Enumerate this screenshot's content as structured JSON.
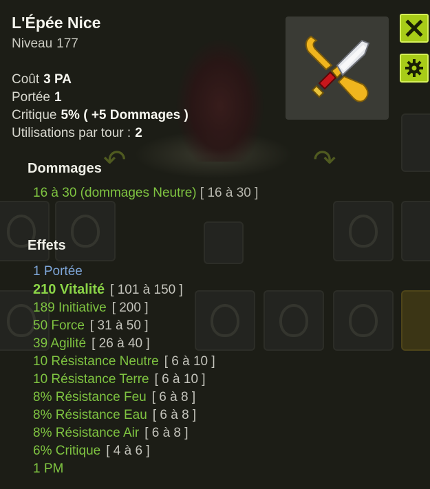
{
  "item": {
    "name": "L'Épée Nice",
    "level_label": "Niveau",
    "level": "177"
  },
  "stats": [
    {
      "label": "Coût",
      "value": "3 PA"
    },
    {
      "label": "Portée",
      "value": "1"
    },
    {
      "label": "Critique",
      "value": "5% ( +5 Dommages )"
    },
    {
      "label": "Utilisations par tour :",
      "value": "2"
    }
  ],
  "damage": {
    "heading": "Dommages",
    "text": "16 à 30 (dommages Neutre)",
    "range": "[ 16 à 30 ]"
  },
  "effects": {
    "heading": "Effets",
    "items": [
      {
        "value": "1 Portée",
        "range": "",
        "style": "blue"
      },
      {
        "value": "210 Vitalité",
        "range": "[ 101 à 150 ]",
        "style": "big"
      },
      {
        "value": "189 Initiative",
        "range": "[ 200 ]",
        "style": ""
      },
      {
        "value": "50 Force",
        "range": "[ 31 à 50 ]",
        "style": ""
      },
      {
        "value": "39 Agilité",
        "range": "[ 26 à 40 ]",
        "style": ""
      },
      {
        "value": "10 Résistance Neutre",
        "range": "[ 6 à 10 ]",
        "style": ""
      },
      {
        "value": "10 Résistance Terre",
        "range": "[ 6 à 10 ]",
        "style": ""
      },
      {
        "value": "8% Résistance Feu",
        "range": "[ 6 à 8 ]",
        "style": ""
      },
      {
        "value": "8% Résistance Eau",
        "range": "[ 6 à 8 ]",
        "style": ""
      },
      {
        "value": "8% Résistance Air",
        "range": "[ 6 à 8 ]",
        "style": ""
      },
      {
        "value": "6% Critique",
        "range": "[ 4 à 6 ]",
        "style": ""
      },
      {
        "value": "1 PM",
        "range": "",
        "style": ""
      }
    ]
  },
  "buttons": {
    "close_icon": "close-icon",
    "settings_icon": "gear-icon"
  },
  "colors": {
    "effect_green": "#7fc441",
    "effect_blue": "#7ea6d8",
    "button_lime": "#a8cc18"
  }
}
